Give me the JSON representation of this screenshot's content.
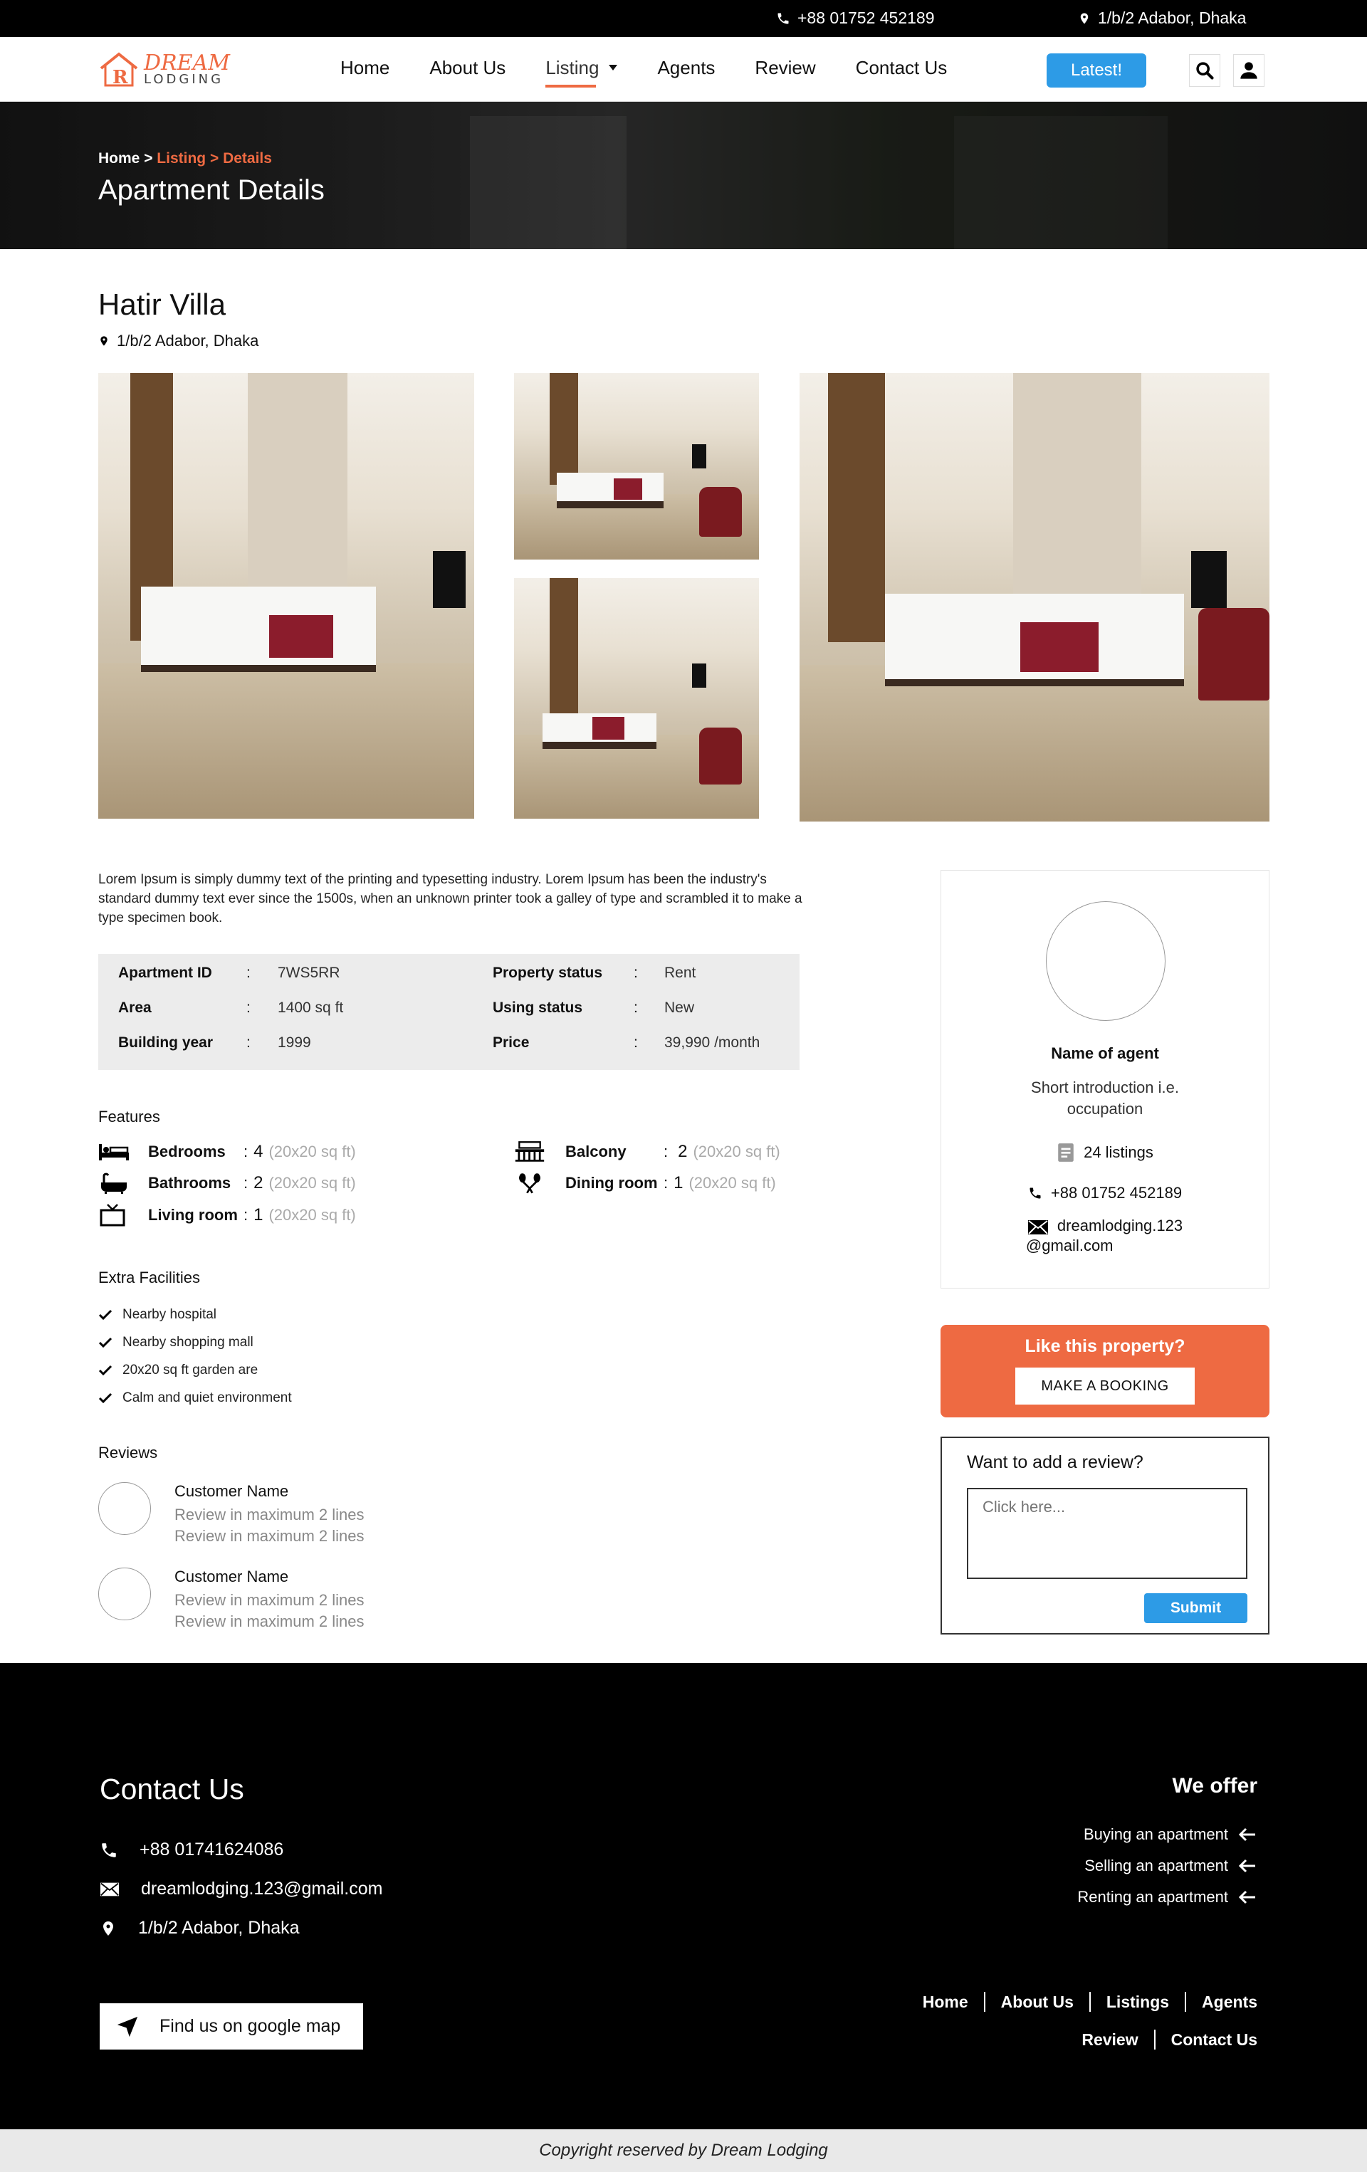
{
  "topbar": {
    "phone": "+88 01752 452189",
    "address": "1/b/2 Adabor, Dhaka"
  },
  "brand": {
    "line1": "DREAM",
    "line2": "LODGING"
  },
  "nav": {
    "items": [
      "Home",
      "About Us",
      "Listing",
      "Agents",
      "Review",
      "Contact Us"
    ],
    "latest": "Latest!"
  },
  "hero": {
    "crumb_home": "Home",
    "crumb_sep1": " > ",
    "crumb_listing": "Listing",
    "crumb_sep2": " > ",
    "crumb_details": "Details",
    "title": "Apartment Details"
  },
  "property": {
    "name": "Hatir Villa",
    "address": "1/b/2 Adabor, Dhaka",
    "description": "Lorem Ipsum is simply dummy text of the printing and typesetting industry. Lorem Ipsum has been the industry's standard dummy text ever since the 1500s, when an unknown printer took a galley of type and scrambled it to make a type specimen book.",
    "specs_left": [
      {
        "key": "Apartment ID",
        "value": "7WS5RR"
      },
      {
        "key": "Area",
        "value": "1400 sq ft"
      },
      {
        "key": "Building year",
        "value": "1999"
      }
    ],
    "specs_right": [
      {
        "key": "Property status",
        "value": "Rent"
      },
      {
        "key": "Using status",
        "value": "New"
      },
      {
        "key": "Price",
        "value": "39,990 /month"
      }
    ],
    "colon": ":"
  },
  "features": {
    "title": "Features",
    "items": [
      {
        "label": "Bedrooms",
        "sep": ":",
        "count": "4",
        "size": "(20x20 sq ft)",
        "icon": "bed-icon"
      },
      {
        "label": "Bathrooms",
        "sep": ":",
        "count": "2",
        "size": "(20x20 sq ft)",
        "icon": "bathtub-icon"
      },
      {
        "label": "Living room",
        "sep": ":",
        "count": "1",
        "size": "(20x20 sq ft)",
        "icon": "tv-icon"
      },
      {
        "label": "Balcony",
        "sep": ":",
        "count": "2",
        "size": "(20x20 sq ft)",
        "icon": "balcony-icon"
      },
      {
        "label": "Dining room",
        "sep": ":",
        "count": "1",
        "size": "(20x20 sq ft)",
        "icon": "dining-icon"
      }
    ]
  },
  "facilities": {
    "title": "Extra Facilities",
    "items": [
      "Nearby hospital",
      "Nearby shopping mall",
      "20x20 sq ft garden are",
      "Calm and quiet environment"
    ]
  },
  "reviews": {
    "title": "Reviews",
    "items": [
      {
        "name": "Customer Name",
        "line1": "Review in maximum 2 lines",
        "line2": "Review in maximum 2 lines"
      },
      {
        "name": "Customer Name",
        "line1": "Review in maximum 2 lines",
        "line2": "Review in maximum 2 lines"
      }
    ]
  },
  "agent": {
    "name": "Name of agent",
    "intro": "Short introduction i.e. occupation",
    "listings": "24 listings",
    "phone": "+88 01752 452189",
    "email_line1": "dreamlodging.123",
    "email_line2": "@gmail.com"
  },
  "cta": {
    "title": "Like this property?",
    "button": "MAKE A BOOKING"
  },
  "review_form": {
    "title": "Want to add a review?",
    "placeholder": "Click here...",
    "submit": "Submit"
  },
  "footer": {
    "contact_title": "Contact Us",
    "phone": "+88 01741624086",
    "email": "dreamlodging.123@gmail.com",
    "address": "1/b/2 Adabor, Dhaka",
    "map_button": "Find us on google map",
    "offer_title": "We offer",
    "offers": [
      "Buying an apartment",
      "Selling an apartment",
      "Renting an apartment"
    ],
    "links_row1": [
      "Home",
      "About Us",
      "Listings",
      "Agents"
    ],
    "links_row2": [
      "Review",
      "Contact Us"
    ]
  },
  "copyright": "Copyright reserved by Dream Lodging",
  "colors": {
    "accent": "#ee6a42",
    "button_blue": "#2d9be6",
    "black": "#000000"
  }
}
